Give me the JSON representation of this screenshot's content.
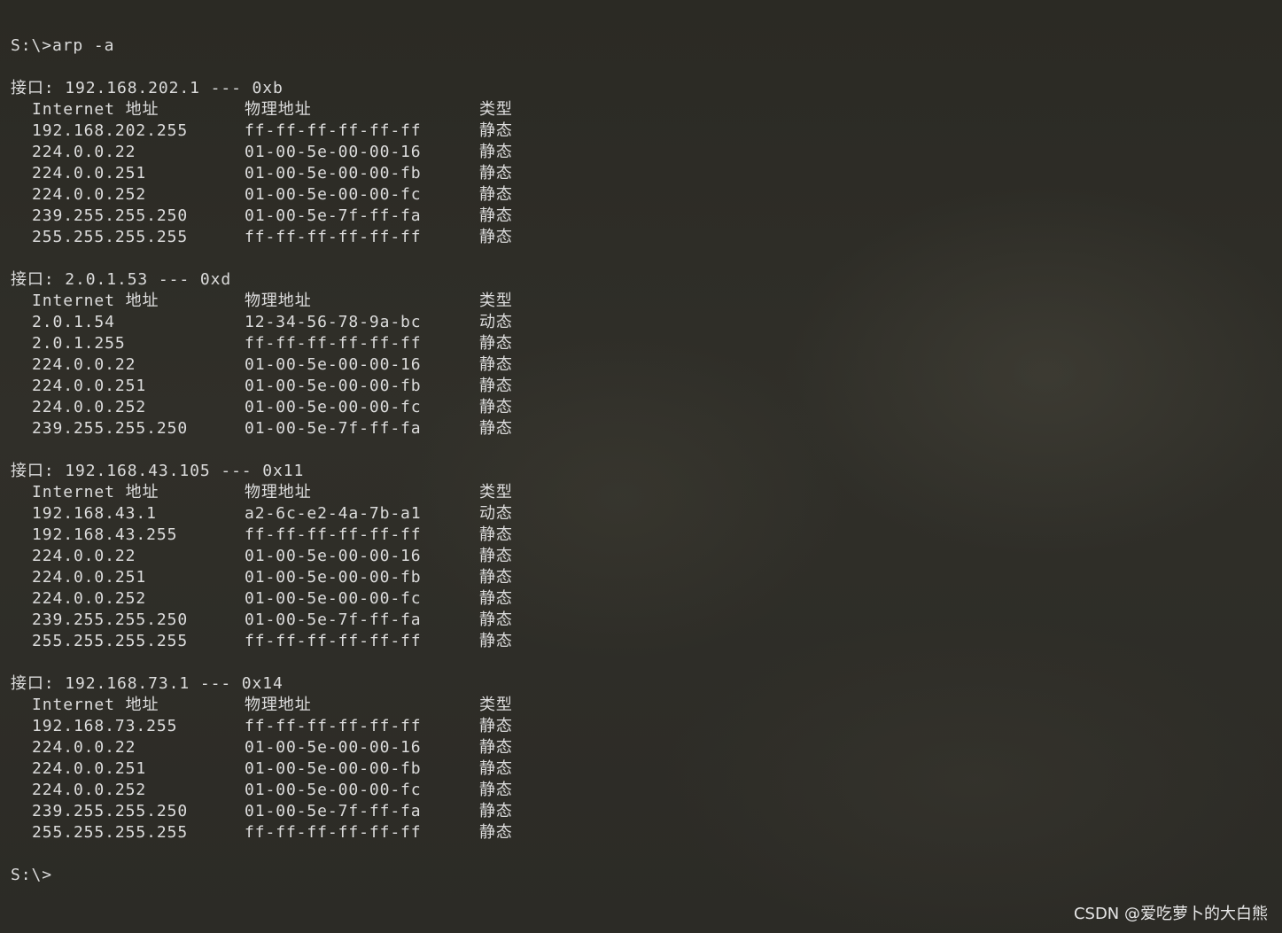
{
  "terminal": {
    "command_line": "S:\\>arp -a",
    "final_prompt": "S:\\>",
    "interfaces": [
      {
        "header": "接口: 192.168.202.1 --- 0xb",
        "columns": {
          "ip": "Internet 地址",
          "mac": "物理地址",
          "type": "类型"
        },
        "rows": [
          {
            "ip": "192.168.202.255",
            "mac": "ff-ff-ff-ff-ff-ff",
            "type": "静态"
          },
          {
            "ip": "224.0.0.22",
            "mac": "01-00-5e-00-00-16",
            "type": "静态"
          },
          {
            "ip": "224.0.0.251",
            "mac": "01-00-5e-00-00-fb",
            "type": "静态"
          },
          {
            "ip": "224.0.0.252",
            "mac": "01-00-5e-00-00-fc",
            "type": "静态"
          },
          {
            "ip": "239.255.255.250",
            "mac": "01-00-5e-7f-ff-fa",
            "type": "静态"
          },
          {
            "ip": "255.255.255.255",
            "mac": "ff-ff-ff-ff-ff-ff",
            "type": "静态"
          }
        ]
      },
      {
        "header": "接口: 2.0.1.53 --- 0xd",
        "columns": {
          "ip": "Internet 地址",
          "mac": "物理地址",
          "type": "类型"
        },
        "rows": [
          {
            "ip": "2.0.1.54",
            "mac": "12-34-56-78-9a-bc",
            "type": "动态"
          },
          {
            "ip": "2.0.1.255",
            "mac": "ff-ff-ff-ff-ff-ff",
            "type": "静态"
          },
          {
            "ip": "224.0.0.22",
            "mac": "01-00-5e-00-00-16",
            "type": "静态"
          },
          {
            "ip": "224.0.0.251",
            "mac": "01-00-5e-00-00-fb",
            "type": "静态"
          },
          {
            "ip": "224.0.0.252",
            "mac": "01-00-5e-00-00-fc",
            "type": "静态"
          },
          {
            "ip": "239.255.255.250",
            "mac": "01-00-5e-7f-ff-fa",
            "type": "静态"
          }
        ]
      },
      {
        "header": "接口: 192.168.43.105 --- 0x11",
        "columns": {
          "ip": "Internet 地址",
          "mac": "物理地址",
          "type": "类型"
        },
        "rows": [
          {
            "ip": "192.168.43.1",
            "mac": "a2-6c-e2-4a-7b-a1",
            "type": "动态"
          },
          {
            "ip": "192.168.43.255",
            "mac": "ff-ff-ff-ff-ff-ff",
            "type": "静态"
          },
          {
            "ip": "224.0.0.22",
            "mac": "01-00-5e-00-00-16",
            "type": "静态"
          },
          {
            "ip": "224.0.0.251",
            "mac": "01-00-5e-00-00-fb",
            "type": "静态"
          },
          {
            "ip": "224.0.0.252",
            "mac": "01-00-5e-00-00-fc",
            "type": "静态"
          },
          {
            "ip": "239.255.255.250",
            "mac": "01-00-5e-7f-ff-fa",
            "type": "静态"
          },
          {
            "ip": "255.255.255.255",
            "mac": "ff-ff-ff-ff-ff-ff",
            "type": "静态"
          }
        ]
      },
      {
        "header": "接口: 192.168.73.1 --- 0x14",
        "columns": {
          "ip": "Internet 地址",
          "mac": "物理地址",
          "type": "类型"
        },
        "rows": [
          {
            "ip": "192.168.73.255",
            "mac": "ff-ff-ff-ff-ff-ff",
            "type": "静态"
          },
          {
            "ip": "224.0.0.22",
            "mac": "01-00-5e-00-00-16",
            "type": "静态"
          },
          {
            "ip": "224.0.0.251",
            "mac": "01-00-5e-00-00-fb",
            "type": "静态"
          },
          {
            "ip": "224.0.0.252",
            "mac": "01-00-5e-00-00-fc",
            "type": "静态"
          },
          {
            "ip": "239.255.255.250",
            "mac": "01-00-5e-7f-ff-fa",
            "type": "静态"
          },
          {
            "ip": "255.255.255.255",
            "mac": "ff-ff-ff-ff-ff-ff",
            "type": "静态"
          }
        ]
      }
    ]
  },
  "watermark": "CSDN @爱吃萝卜的大白熊"
}
